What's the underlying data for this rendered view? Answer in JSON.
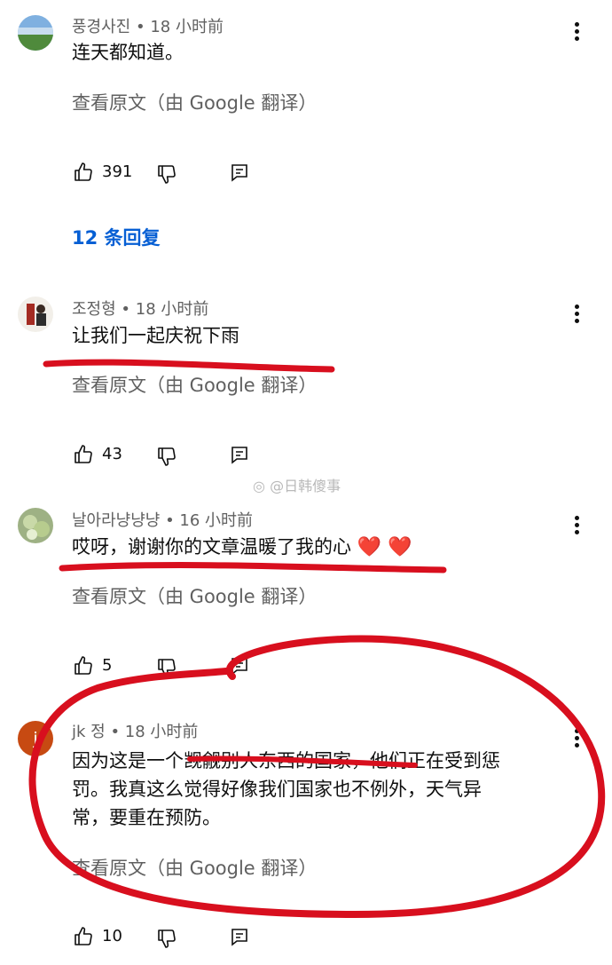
{
  "comments": [
    {
      "author": "풍경사진",
      "time": "• 18 小时前",
      "text": "连天都知道。",
      "translate": "查看原文（由 Google 翻译）",
      "likes": "391",
      "replies": "12 条回复"
    },
    {
      "author": "조정형",
      "time": "• 18 小时前",
      "text": "让我们一起庆祝下雨",
      "translate": "查看原文（由 Google 翻译）",
      "likes": "43"
    },
    {
      "author": "날아라냥냥냥",
      "time": "• 16 小时前",
      "text": "哎呀，谢谢你的文章温暖了我的心",
      "hearts": "❤️ ❤️",
      "translate": "查看原文（由 Google 翻译）",
      "likes": "5"
    },
    {
      "author": "jk 정",
      "time": "• 18 小时前",
      "avatar_letter": "j",
      "text_lines": [
        "因为这是一个觊觎别人东西的国家，他们正在受到惩",
        "罚。我真这么觉得好像我们国家也不例外，天气异",
        "常，要重在预防。"
      ],
      "translate": "查看原文（由 Google 翻译）",
      "likes": "10"
    }
  ],
  "watermark": "@日韩傻事",
  "colors": {
    "link_blue": "#065fd4",
    "annotation_red": "#d80f1e",
    "meta_gray": "#606060",
    "avatar_j": "#c74a12"
  }
}
